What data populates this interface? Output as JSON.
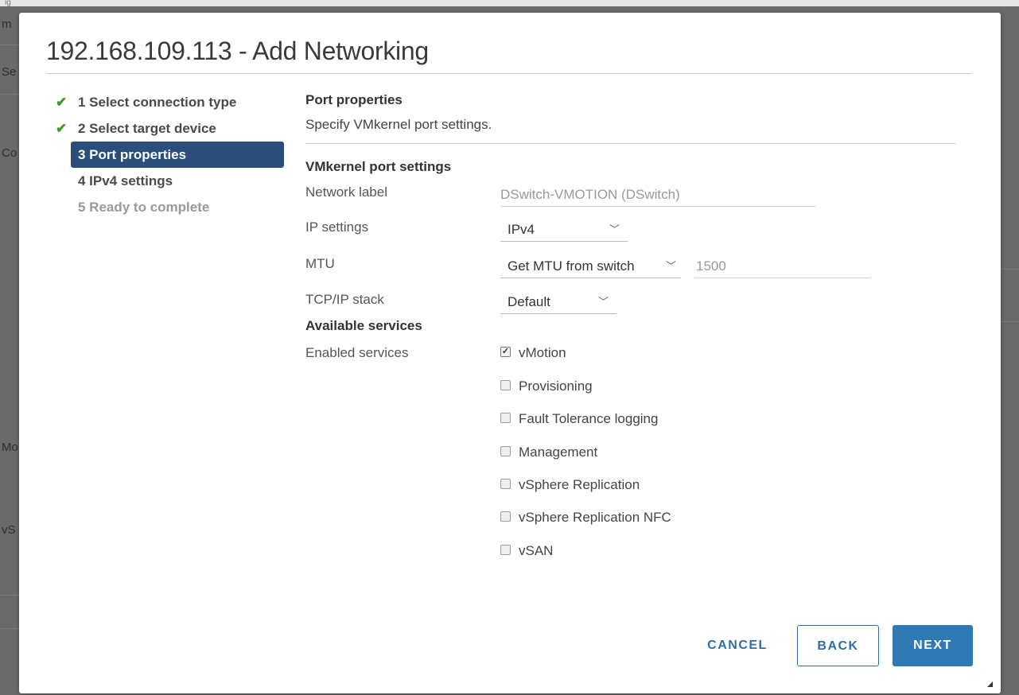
{
  "background": {
    "top_fragment": "ig",
    "side_fragments": [
      "m",
      "Se",
      "Co",
      "Mo",
      "vS"
    ]
  },
  "dialog": {
    "title": "192.168.109.113 - Add Networking"
  },
  "steps": [
    {
      "label": "1 Select connection type",
      "state": "done",
      "icon": "check-icon"
    },
    {
      "label": "2 Select target device",
      "state": "done",
      "icon": "check-icon"
    },
    {
      "label": "3 Port properties",
      "state": "active"
    },
    {
      "label": "4 IPv4 settings",
      "state": "pending"
    },
    {
      "label": "5 Ready to complete",
      "state": "disabled"
    }
  ],
  "content": {
    "title": "Port properties",
    "description": "Specify VMkernel port settings.",
    "vmkernel_heading": "VMkernel port settings",
    "network_label": {
      "label": "Network label",
      "value": "DSwitch-VMOTION (DSwitch)"
    },
    "ip_settings": {
      "label": "IP settings",
      "value": "IPv4"
    },
    "mtu": {
      "label": "MTU",
      "value": "Get MTU from switch",
      "number": "1500"
    },
    "tcpip_stack": {
      "label": "TCP/IP stack",
      "value": "Default"
    },
    "available_services_heading": "Available services",
    "enabled_services_label": "Enabled services",
    "services": [
      {
        "label": "vMotion",
        "checked": true
      },
      {
        "label": "Provisioning",
        "checked": false
      },
      {
        "label": "Fault Tolerance logging",
        "checked": false
      },
      {
        "label": "Management",
        "checked": false
      },
      {
        "label": "vSphere Replication",
        "checked": false
      },
      {
        "label": "vSphere Replication NFC",
        "checked": false
      },
      {
        "label": "vSAN",
        "checked": false
      }
    ]
  },
  "buttons": {
    "cancel": "CANCEL",
    "back": "BACK",
    "next": "NEXT"
  },
  "colors": {
    "active_step_bg": "#2b4d7a",
    "check_green": "#3c9a28",
    "primary_blue": "#2f79b5"
  }
}
